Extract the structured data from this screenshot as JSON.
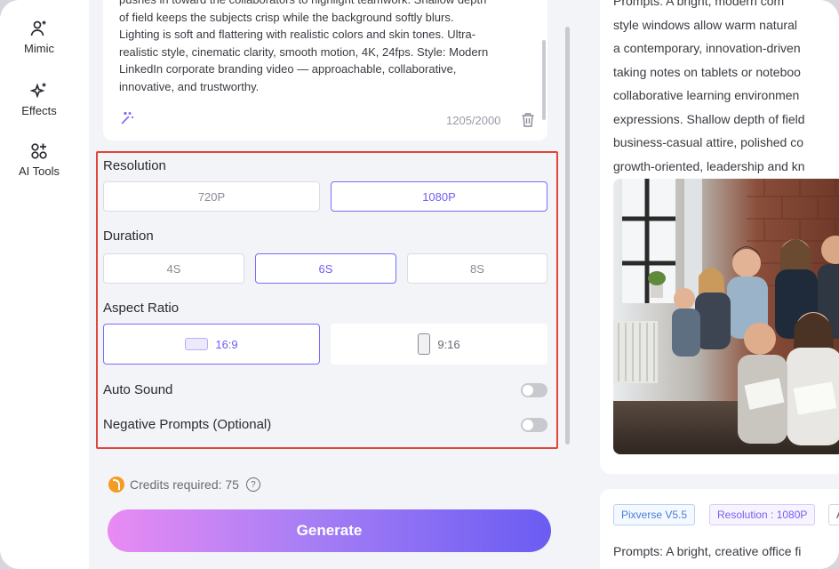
{
  "rail": {
    "items": [
      {
        "label": "Mimic",
        "icon": "person-sparkle-icon"
      },
      {
        "label": "Effects",
        "icon": "sparkles-icon"
      },
      {
        "label": "AI Tools",
        "icon": "grid-sparkle-icon"
      }
    ]
  },
  "prompt": {
    "lines": [
      "pushes in toward the collaborators to highlight teamwork. Shallow depth",
      "of field keeps the subjects crisp while the background softly blurs.",
      "Lighting is soft and flattering with realistic colors and skin tones. Ultra-",
      "realistic style, cinematic clarity, smooth motion, 4K, 24fps. Style: Modern",
      "LinkedIn corporate branding video — approachable, collaborative,",
      "innovative, and trustworthy."
    ],
    "counter": "1205/2000"
  },
  "settings": {
    "resolution": {
      "title": "Resolution",
      "options": [
        "720P",
        "1080P"
      ],
      "selected": "1080P"
    },
    "duration": {
      "title": "Duration",
      "options": [
        "4S",
        "6S",
        "8S"
      ],
      "selected": "6S"
    },
    "aspect": {
      "title": "Aspect Ratio",
      "options": [
        "16:9",
        "9:16"
      ],
      "selected": "16:9"
    },
    "auto_sound": {
      "label": "Auto Sound",
      "enabled": false
    },
    "negative_prompts": {
      "label": "Negative Prompts (Optional)",
      "enabled": false
    }
  },
  "credits": {
    "text": "Credits required: 75"
  },
  "generate": {
    "label": "Generate"
  },
  "colors": {
    "accent": "#6f5ff2",
    "highlight_border": "#e0443a"
  },
  "preview": {
    "lines": [
      "Prompts: A bright, modern com",
      "style windows allow warm natural",
      "a contemporary, innovation-driven",
      "taking notes on tablets or noteboo",
      "collaborative learning environmen",
      "expressions. Shallow depth of field",
      "business-casual attire, polished co",
      "growth-oriented, leadership and kn"
    ],
    "tags": [
      "Pixverse V5.5",
      "Resolution : 1080P",
      "A"
    ],
    "prompt_start": "Prompts: A bright, creative office fi"
  }
}
